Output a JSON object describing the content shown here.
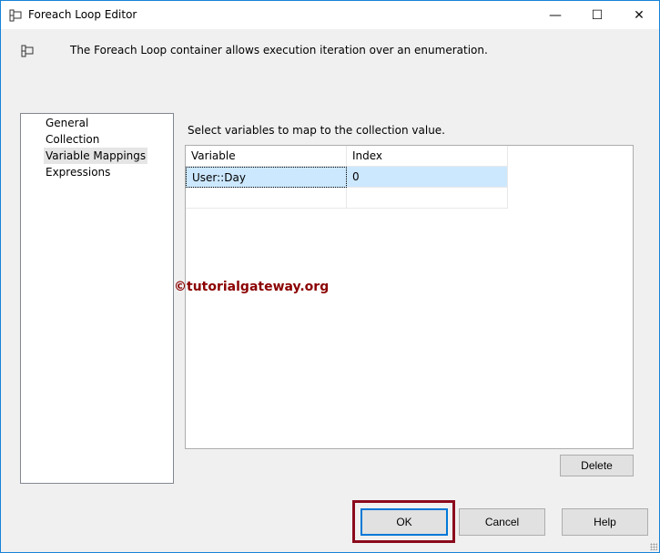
{
  "window": {
    "title": "Foreach Loop Editor",
    "minimize_icon": "minimize-icon",
    "maximize_icon": "maximize-icon",
    "close_icon": "close-icon"
  },
  "header": {
    "description": "The Foreach Loop container allows execution iteration over an enumeration."
  },
  "sidebar": {
    "items": [
      {
        "label": "General"
      },
      {
        "label": "Collection"
      },
      {
        "label": "Variable Mappings",
        "selected": true
      },
      {
        "label": "Expressions"
      }
    ]
  },
  "main": {
    "instruction": "Select variables to map to the collection value.",
    "columns": [
      "Variable",
      "Index"
    ],
    "rows": [
      {
        "variable": "User::Day",
        "index": "0"
      }
    ],
    "delete_label": "Delete"
  },
  "watermark": "©tutorialgateway.org",
  "footer": {
    "ok_label": "OK",
    "cancel_label": "Cancel",
    "help_label": "Help"
  },
  "colors": {
    "selection": "#cce8ff",
    "highlight_frame": "#8b0a1c",
    "focus": "#0078d7"
  }
}
